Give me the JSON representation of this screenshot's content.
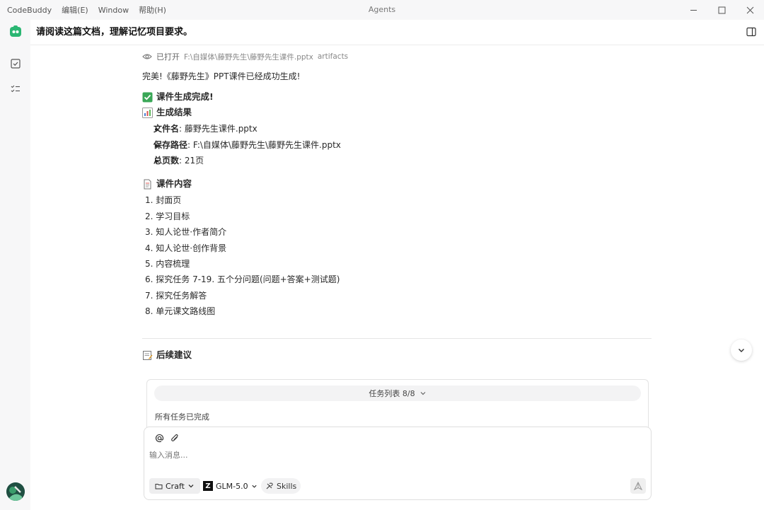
{
  "menu": [
    "CodeBuddy",
    "编辑(E)",
    "Window",
    "帮助(H)"
  ],
  "window_title": "Agents",
  "header": {
    "title": "请阅读这篇文档，理解记忆项目要求。"
  },
  "opened": {
    "label": "已打开",
    "path": "F:\\自媒体\\藤野先生\\藤野先生课件.pptx",
    "tag": "artifacts"
  },
  "intro": "完美!《藤野先生》PPT课件已经成功生成!",
  "done_heading": "课件生成完成!",
  "result_heading": "生成结果",
  "results": [
    {
      "label": "文件名",
      "value": ": 藤野先生课件.pptx"
    },
    {
      "label": "保存路径",
      "value": ": F:\\自媒体\\藤野先生\\藤野先生课件.pptx"
    },
    {
      "label": "总页数",
      "value": ": 21页"
    }
  ],
  "content_heading": "课件内容",
  "contents": [
    "1. 封面页",
    "2. 学习目标",
    "3. 知人论世·作者简介",
    "4. 知人论世·创作背景",
    "5. 内容梳理",
    "6. 探究任务 7-19. 五个分问题(问题+答案+测试题)",
    "7. 探究任务解答",
    "8. 单元课文路线图"
  ],
  "followup_heading": "后续建议",
  "tasks": {
    "pill": "任务列表 8/8",
    "status": "所有任务已完成"
  },
  "input": {
    "placeholder": "输入消息...",
    "craft_label": "Craft",
    "model_label": "GLM-5.0",
    "skills_label": "Skills"
  },
  "icons": {
    "at": "at-icon",
    "attach": "paperclip-icon",
    "send": "send-icon",
    "check": "check-icon",
    "chart": "bar-chart-icon",
    "doc": "document-icon",
    "note": "memo-icon"
  }
}
